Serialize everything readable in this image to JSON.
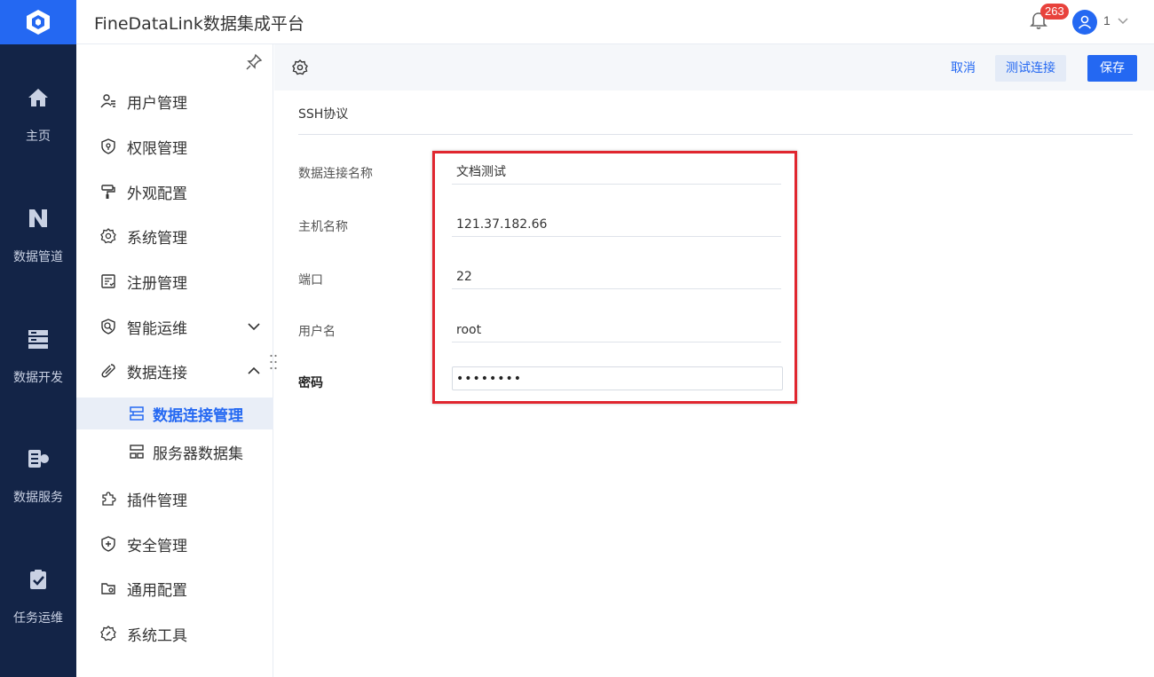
{
  "app": {
    "title": "FineDataLink数据集成平台"
  },
  "header": {
    "notification_count": "263",
    "user_name": "1"
  },
  "rail": {
    "items": [
      {
        "label": "主页",
        "icon": "home-icon"
      },
      {
        "label": "数据管道",
        "icon": "pipeline-icon"
      },
      {
        "label": "数据开发",
        "icon": "develop-icon"
      },
      {
        "label": "数据服务",
        "icon": "service-icon"
      },
      {
        "label": "任务运维",
        "icon": "task-ops-icon"
      }
    ]
  },
  "sidebar": {
    "items": [
      {
        "label": "用户管理",
        "icon": "user-manage-icon"
      },
      {
        "label": "权限管理",
        "icon": "permission-icon"
      },
      {
        "label": "外观配置",
        "icon": "appearance-icon"
      },
      {
        "label": "系统管理",
        "icon": "system-gear-icon"
      },
      {
        "label": "注册管理",
        "icon": "register-icon"
      },
      {
        "label": "智能运维",
        "icon": "smart-ops-icon"
      },
      {
        "label": "数据连接",
        "icon": "data-connection-icon"
      },
      {
        "label": "插件管理",
        "icon": "plugin-icon"
      },
      {
        "label": "安全管理",
        "icon": "security-shield-icon"
      },
      {
        "label": "通用配置",
        "icon": "general-config-icon"
      },
      {
        "label": "系统工具",
        "icon": "system-tool-icon"
      }
    ],
    "sub_items": [
      {
        "label": "数据连接管理",
        "icon": "connection-manage-icon",
        "active": true
      },
      {
        "label": "服务器数据集",
        "icon": "server-dataset-icon",
        "active": false
      }
    ]
  },
  "toolbar": {
    "cancel_label": "取消",
    "test_label": "测试连接",
    "save_label": "保存"
  },
  "form": {
    "section_title": "SSH协议",
    "connection_name_label": "数据连接名称",
    "connection_name_value": "文档测试",
    "host_label": "主机名称",
    "host_value": "121.37.182.66",
    "port_label": "端口",
    "port_value": "22",
    "username_label": "用户名",
    "username_value": "root",
    "password_label": "密码",
    "password_value": "11111111"
  },
  "colors": {
    "accent": "#2468f2",
    "rail_bg": "#132447",
    "badge": "#e8423c",
    "highlight": "#e0262f"
  }
}
